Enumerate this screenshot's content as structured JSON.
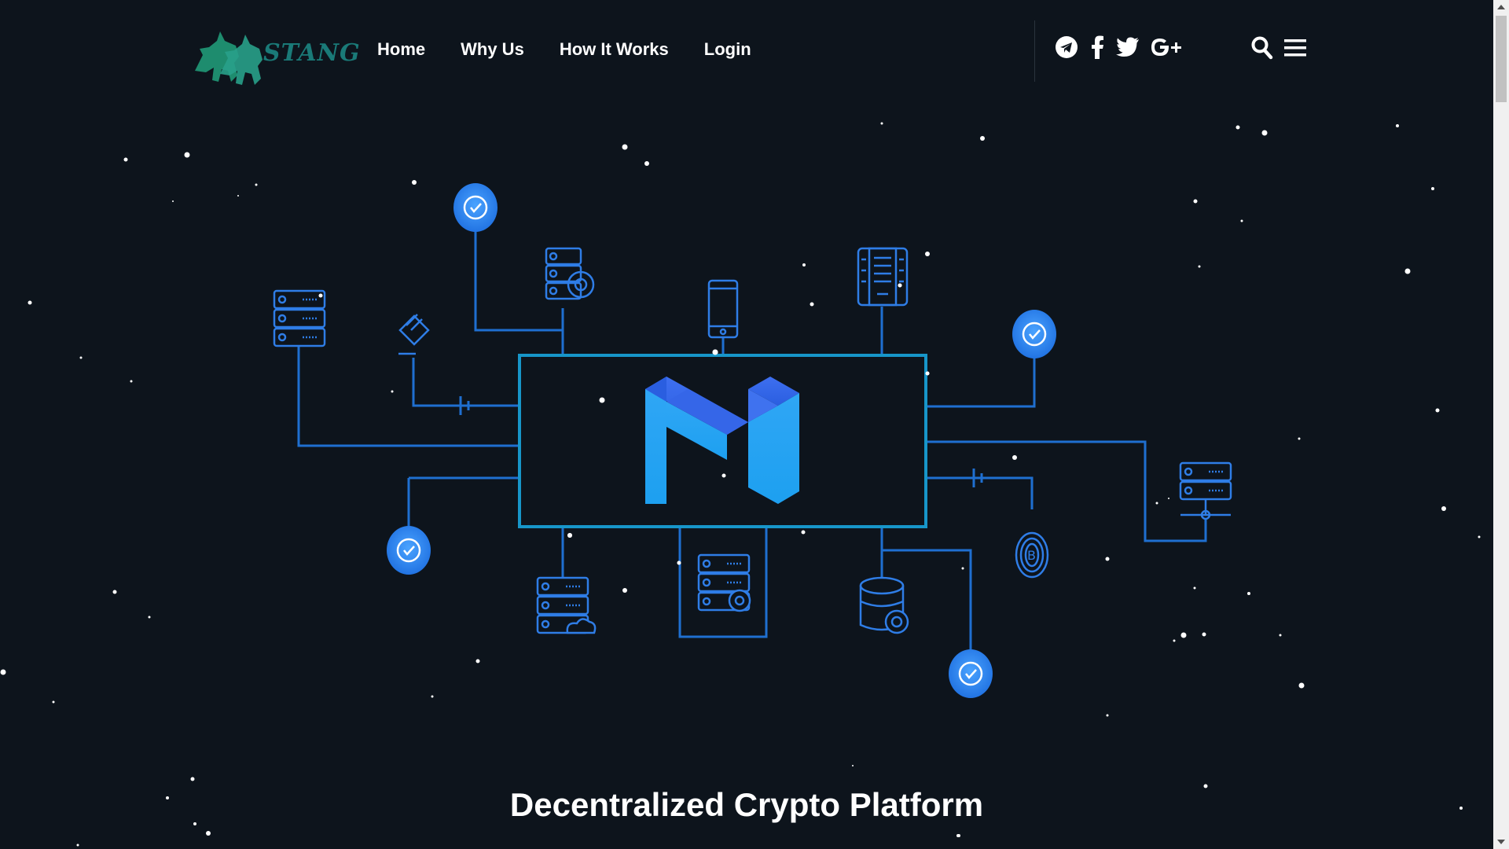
{
  "brand": {
    "name": "STANG"
  },
  "nav": {
    "links": [
      {
        "label": "Home"
      },
      {
        "label": "Why Us"
      },
      {
        "label": "How It Works"
      },
      {
        "label": "Login"
      }
    ]
  },
  "social": [
    "telegram-icon",
    "facebook-icon",
    "twitter-icon",
    "google-plus-icon"
  ],
  "tools": [
    "search-icon",
    "menu-icon"
  ],
  "hero": {
    "headline": "Decentralized Crypto Platform"
  },
  "colors": {
    "background": "#0d141c",
    "accent": "#2f8de4",
    "line": "#1f6fd0",
    "box": "#1796c9"
  }
}
